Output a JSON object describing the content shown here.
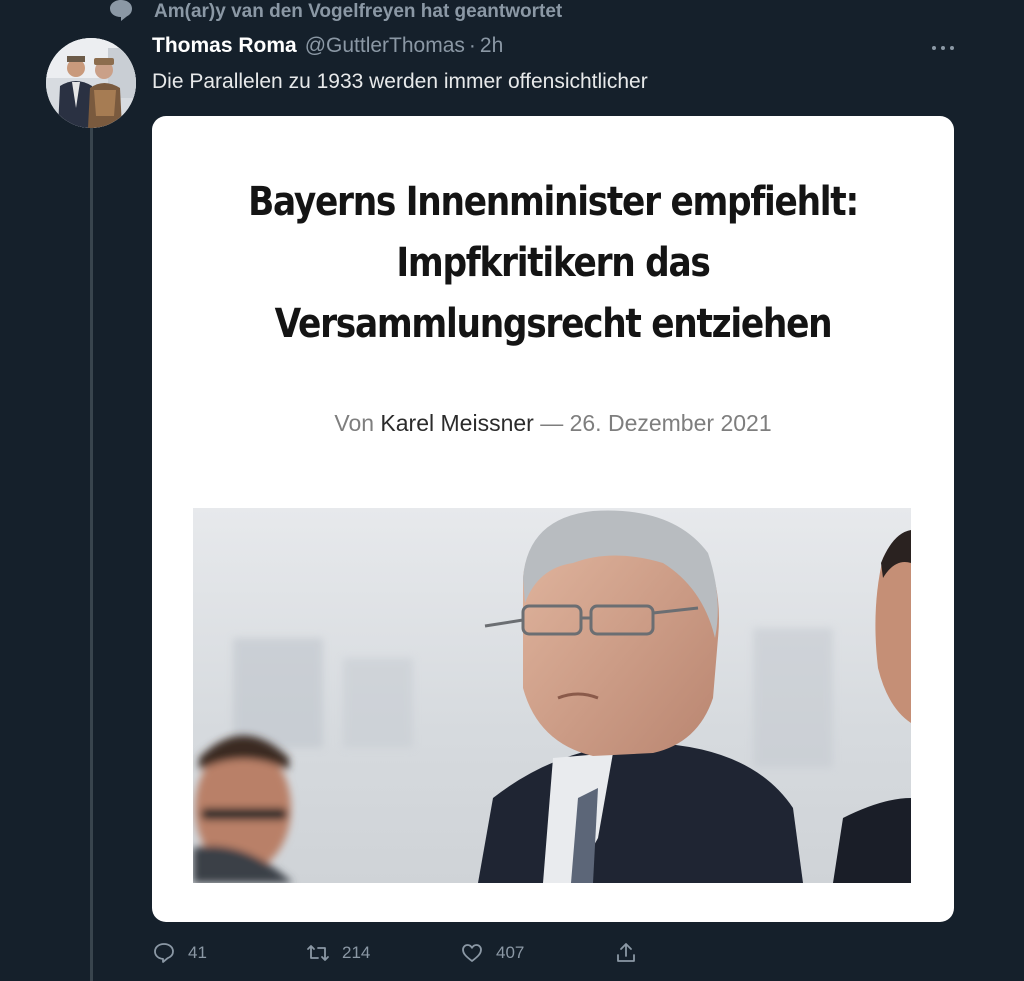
{
  "context": {
    "icon": "reply-bubble-icon",
    "text": "Am(ar)y van den Vogelfreyen hat geantwortet"
  },
  "tweet": {
    "author_name": "Thomas Roma",
    "author_handle": "@GuttlerThomas",
    "separator": "·",
    "timestamp": "2h",
    "text": "Die Parallelen zu 1933 werden immer offensichtlicher",
    "more_icon": "more-dots-icon"
  },
  "media": {
    "headline_lines": [
      "Bayerns Innenminister empfiehlt:",
      "Impfkritikern das",
      "Versammlungsrecht entziehen"
    ],
    "byline_prefix": "Von",
    "byline_author": "Karel Meissner",
    "byline_dash": "—",
    "byline_date": "26. Dezember 2021"
  },
  "actions": {
    "reply": {
      "icon": "reply-icon",
      "count": "41"
    },
    "retweet": {
      "icon": "retweet-icon",
      "count": "214"
    },
    "like": {
      "icon": "heart-icon",
      "count": "407"
    },
    "share": {
      "icon": "share-icon"
    }
  },
  "colors": {
    "background": "#15202b",
    "muted_text": "#8b98a5",
    "primary_text": "#e7e9ea",
    "thread_line": "#38444d"
  }
}
